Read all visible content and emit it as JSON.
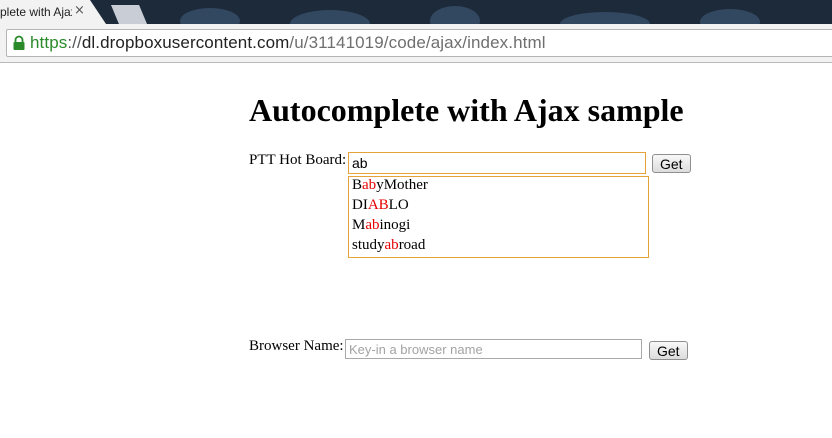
{
  "browser": {
    "tab_title": "plete with Ajax",
    "tab_close": "×",
    "url": {
      "scheme": "https",
      "separator": "://",
      "host": "dl.dropboxusercontent.com",
      "path": "/u/31141019/code/ajax/index.html"
    }
  },
  "page": {
    "title": "Autocomplete with Ajax sample",
    "ptt": {
      "label": "PTT Hot Board:",
      "input_value": "ab",
      "button_label": "Get",
      "suggestions": [
        {
          "before": "B",
          "match": "ab",
          "after": "yMother"
        },
        {
          "before": "DI",
          "match": "AB",
          "after": "LO"
        },
        {
          "before": "M",
          "match": "ab",
          "after": "inogi"
        },
        {
          "before": "study",
          "match": "ab",
          "after": "road"
        }
      ]
    },
    "browser_name": {
      "label": "Browser Name:",
      "placeholder": "Key-in a browser name",
      "button_label": "Get"
    }
  },
  "colors": {
    "highlight": "#e60000",
    "focus_border": "#e5a13a",
    "url_scheme": "#2a8a2a"
  }
}
